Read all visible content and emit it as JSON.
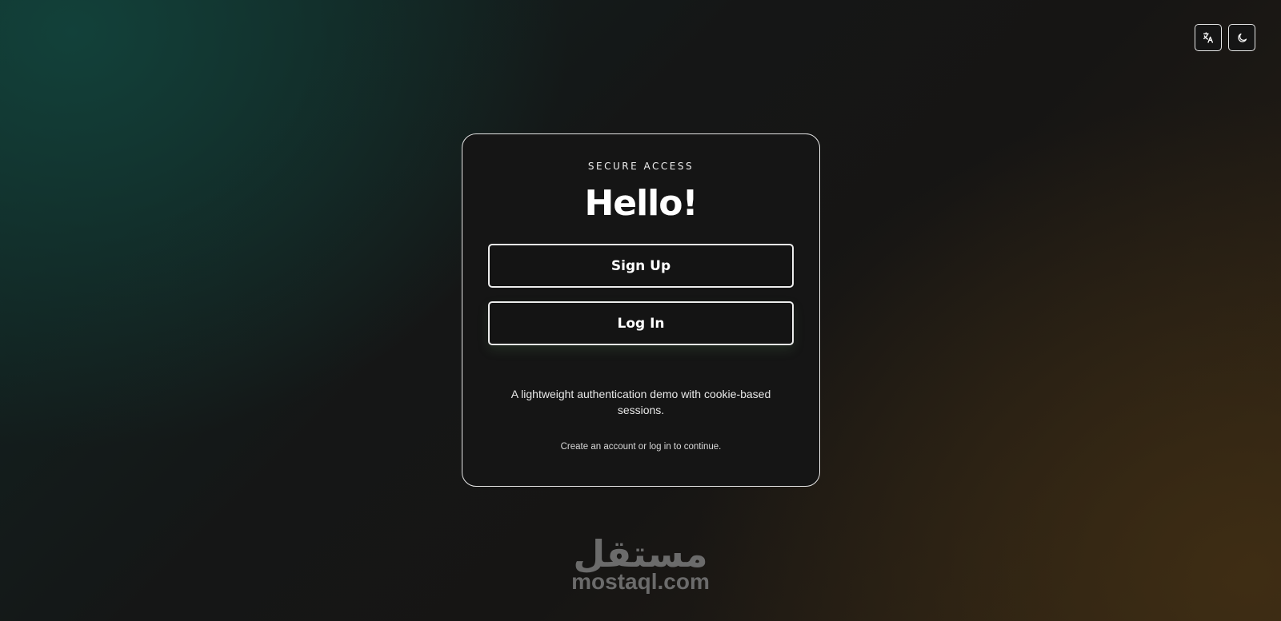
{
  "header": {
    "translate_icon": "translate-icon",
    "theme_icon": "moon-icon"
  },
  "card": {
    "eyebrow": "SECURE ACCESS",
    "title": "Hello!",
    "signup_label": "Sign Up",
    "login_label": "Log In",
    "description": "A lightweight authentication demo with cookie-based sessions.",
    "hint": "Create an account or log in to continue."
  },
  "watermark": {
    "arabic": "مستقل",
    "latin": "mostaql.com"
  },
  "colors": {
    "background": "#141414",
    "card_border": "#e6e6e6",
    "text": "#ffffff",
    "watermark": "#6b6b6b"
  }
}
